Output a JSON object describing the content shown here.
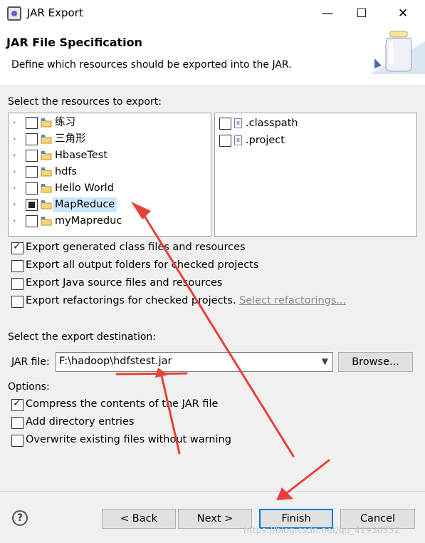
{
  "window": {
    "title": "JAR Export",
    "min": "—",
    "max": "☐",
    "close": "✕"
  },
  "header": {
    "title": "JAR File Specification",
    "description": "Define which resources should be exported into the JAR."
  },
  "resources": {
    "label": "Select the resources to export:",
    "projects": [
      {
        "label": "练习",
        "state": "unchecked"
      },
      {
        "label": "三角形",
        "state": "unchecked"
      },
      {
        "label": "HbaseTest",
        "state": "unchecked"
      },
      {
        "label": "hdfs",
        "state": "unchecked"
      },
      {
        "label": "Hello World",
        "state": "unchecked"
      },
      {
        "label": "MapReduce",
        "state": "partial",
        "selected": true
      },
      {
        "label": "myMapreduc",
        "state": "unchecked"
      }
    ],
    "files": [
      {
        "label": ".classpath"
      },
      {
        "label": ".project"
      }
    ]
  },
  "options_top": {
    "export_class_files": {
      "label": "Export generated class files and resources",
      "checked": true
    },
    "export_output_folders": {
      "label": "Export all output folders for checked projects",
      "checked": false
    },
    "export_java_source": {
      "label": "Export Java source files and resources",
      "checked": false
    },
    "export_refactorings": {
      "label": "Export refactorings for checked projects.",
      "checked": false
    },
    "select_refactorings_link": "Select refactorings..."
  },
  "destination": {
    "label": "Select the export destination:",
    "jar_file_label": "JAR file:",
    "jar_file_value": "F:\\hadoop\\hdfstest.jar",
    "browse": "Browse..."
  },
  "options": {
    "label": "Options:",
    "compress": {
      "label": "Compress the contents of the JAR file",
      "checked": true
    },
    "add_directory": {
      "label": "Add directory entries",
      "checked": false
    },
    "overwrite": {
      "label": "Overwrite existing files without warning",
      "checked": false
    }
  },
  "footer": {
    "help": "?",
    "back": "< Back",
    "next": "Next >",
    "finish": "Finish",
    "cancel": "Cancel",
    "watermark": "https://blog.csdn.net/qq_41930352"
  },
  "colors": {
    "annotation": "#e8403a",
    "selection": "#cce8ff",
    "default_button_border": "#0078d7"
  }
}
